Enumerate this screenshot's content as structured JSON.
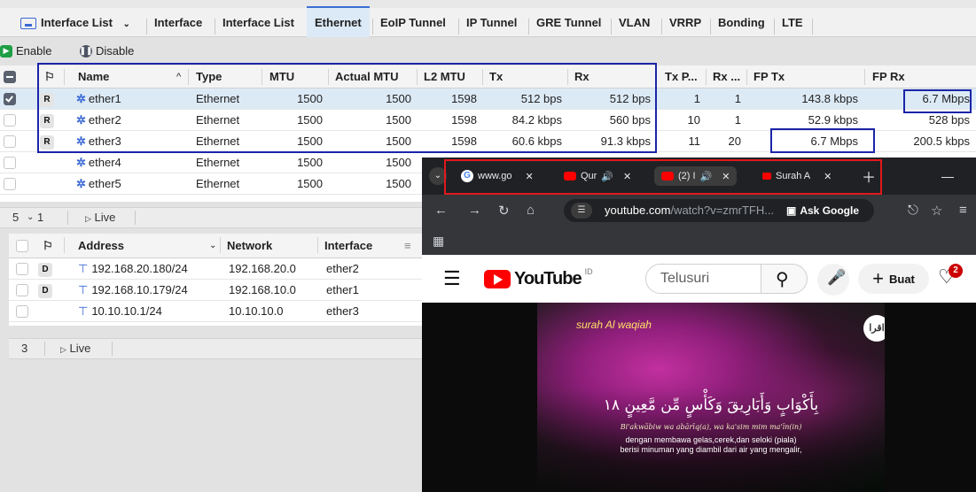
{
  "tabs": [
    {
      "label": "Interface List"
    },
    {
      "label": "Interface"
    },
    {
      "label": "Interface List"
    },
    {
      "label": "Ethernet"
    },
    {
      "label": "EoIP Tunnel"
    },
    {
      "label": "IP Tunnel"
    },
    {
      "label": "GRE Tunnel"
    },
    {
      "label": "VLAN"
    },
    {
      "label": "VRRP"
    },
    {
      "label": "Bonding"
    },
    {
      "label": "LTE"
    }
  ],
  "toolbar": {
    "enable": "Enable",
    "disable": "Disable"
  },
  "columns": {
    "flag": "",
    "name": "Name",
    "type": "Type",
    "mtu": "MTU",
    "actual_mtu": "Actual MTU",
    "l2_mtu": "L2 MTU",
    "tx": "Tx",
    "rx": "Rx",
    "tx_p": "Tx P...",
    "rx_p": "Rx ...",
    "fp_tx": "FP Tx",
    "fp_rx": "FP Rx"
  },
  "interfaces": [
    {
      "flag": "R",
      "name": "ether1",
      "type": "Ethernet",
      "mtu": "1500",
      "actual_mtu": "1500",
      "l2_mtu": "1598",
      "tx": "512 bps",
      "rx": "512 bps",
      "tx_p": "1",
      "rx_p": "1",
      "fp_tx": "143.8 kbps",
      "fp_rx": "6.7 Mbps"
    },
    {
      "flag": "R",
      "name": "ether2",
      "type": "Ethernet",
      "mtu": "1500",
      "actual_mtu": "1500",
      "l2_mtu": "1598",
      "tx": "84.2 kbps",
      "rx": "560 bps",
      "tx_p": "10",
      "rx_p": "1",
      "fp_tx": "52.9 kbps",
      "fp_rx": "528 bps"
    },
    {
      "flag": "R",
      "name": "ether3",
      "type": "Ethernet",
      "mtu": "1500",
      "actual_mtu": "1500",
      "l2_mtu": "1598",
      "tx": "60.6 kbps",
      "rx": "91.3 kbps",
      "tx_p": "11",
      "rx_p": "20",
      "fp_tx": "6.7 Mbps",
      "fp_rx": "200.5 kbps"
    },
    {
      "flag": "",
      "name": "ether4",
      "type": "Ethernet",
      "mtu": "1500",
      "actual_mtu": "1500"
    },
    {
      "flag": "",
      "name": "ether5",
      "type": "Ethernet",
      "mtu": "1500",
      "actual_mtu": "1500"
    }
  ],
  "iface_status": {
    "count": "5",
    "selected": "1",
    "live": "Live"
  },
  "addr_columns": {
    "address": "Address",
    "network": "Network",
    "interface": "Interface"
  },
  "addresses": [
    {
      "flag": "D",
      "address": "192.168.20.180/24",
      "network": "192.168.20.0",
      "interface": "ether2"
    },
    {
      "flag": "D",
      "address": "192.168.10.179/24",
      "network": "192.168.10.0",
      "interface": "ether1"
    },
    {
      "flag": "",
      "address": "10.10.10.1/24",
      "network": "10.10.10.0",
      "interface": "ether3"
    }
  ],
  "addr_status": {
    "count": "3",
    "live": "Live"
  },
  "browser": {
    "tabs": [
      {
        "label": "www.go"
      },
      {
        "label": "Qur"
      },
      {
        "label": "(2) I"
      },
      {
        "label": "Surah A"
      }
    ],
    "url_host": "youtube.com",
    "url_path": "/watch?v=zmrTFH...",
    "ask_google": "Ask Google",
    "yt_logo": "YouTube",
    "yt_region": "ID",
    "search_placeholder": "Telusuri",
    "create_label": "Buat",
    "notif_count": "2",
    "video": {
      "title": "surah Al waqiah",
      "badge": "اقرا",
      "arabic": "بِأَكْوَابٍ وَأَبَارِيقَ وَكَأْسٍ مِّن مَّعِينٍ ١٨",
      "translit": "Bi'akwābiw wa abārīq(a), wa ka'sim mim ma'īn(in)",
      "line1": "dengan membawa gelas,cerek,dan seloki (piala)",
      "line2": "berisi minuman yang diambil dari air yang mengalir,"
    }
  },
  "colors": {
    "highlight_blue": "#1b24a8",
    "highlight_red": "#e0191d",
    "active_tab": "#dceaf7",
    "yt_red": "#ff0000"
  }
}
